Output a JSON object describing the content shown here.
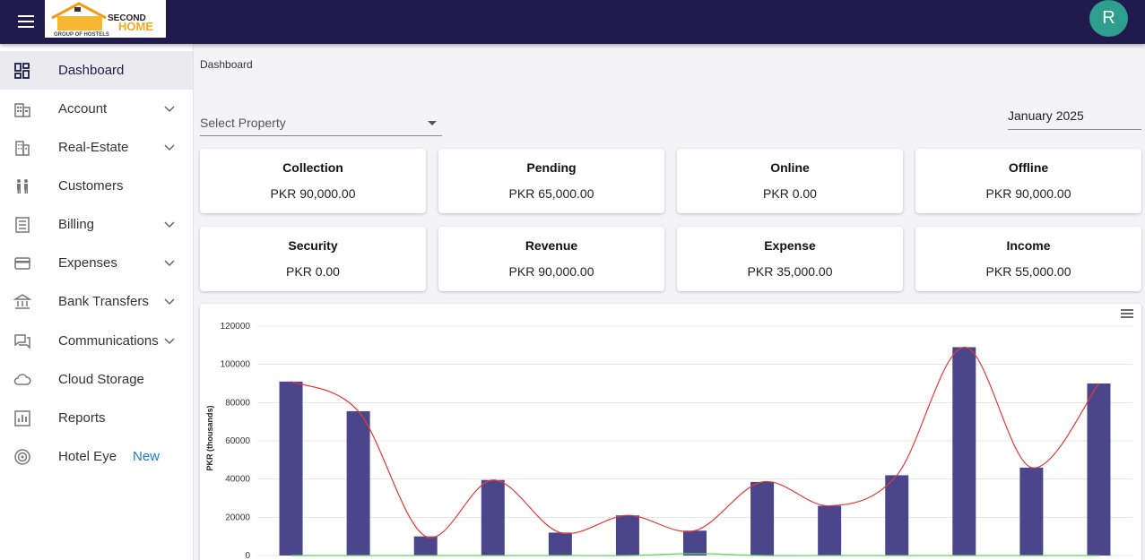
{
  "header": {
    "logo": {
      "top_word": "SECOND",
      "brand": "HOME",
      "tagline": "GROUP OF HOSTELS"
    },
    "avatar_initial": "R",
    "colors": {
      "topbar": "#201a4f",
      "avatar": "#2e9e8f"
    }
  },
  "sidebar": {
    "items": [
      {
        "label": "Dashboard",
        "icon": "dashboard-icon",
        "expandable": false,
        "active": true
      },
      {
        "label": "Account",
        "icon": "building-icon",
        "expandable": true
      },
      {
        "label": "Real-Estate",
        "icon": "apartment-icon",
        "expandable": true
      },
      {
        "label": "Customers",
        "icon": "people-icon",
        "expandable": false
      },
      {
        "label": "Billing",
        "icon": "receipt-icon",
        "expandable": true
      },
      {
        "label": "Expenses",
        "icon": "credit-card-icon",
        "expandable": true
      },
      {
        "label": "Bank Transfers",
        "icon": "bank-icon",
        "expandable": true
      },
      {
        "label": "Communications",
        "icon": "chat-icon",
        "expandable": true
      },
      {
        "label": "Cloud Storage",
        "icon": "cloud-icon",
        "expandable": false
      },
      {
        "label": "Reports",
        "icon": "bar-chart-icon",
        "expandable": false
      },
      {
        "label": "Hotel Eye",
        "icon": "radar-icon",
        "expandable": false,
        "badge": "New"
      }
    ]
  },
  "breadcrumb": "Dashboard",
  "filters": {
    "property_placeholder": "Select Property",
    "month": "January 2025"
  },
  "cards": [
    {
      "title": "Collection",
      "value": "PKR 90,000.00"
    },
    {
      "title": "Pending",
      "value": "PKR 65,000.00"
    },
    {
      "title": "Online",
      "value": "PKR 0.00"
    },
    {
      "title": "Offline",
      "value": "PKR 90,000.00"
    },
    {
      "title": "Security",
      "value": "PKR 0.00"
    },
    {
      "title": "Revenue",
      "value": "PKR 90,000.00"
    },
    {
      "title": "Expense",
      "value": "PKR 35,000.00"
    },
    {
      "title": "Income",
      "value": "PKR 55,000.00"
    }
  ],
  "chart_data": {
    "type": "bar",
    "ylabel": "PKR (thousands)",
    "ylim": [
      0,
      120000
    ],
    "yticks": [
      0,
      20000,
      40000,
      60000,
      80000,
      100000,
      120000
    ],
    "grid": true,
    "series": [
      {
        "type": "bar",
        "color": "#4b468c",
        "values": [
          91000,
          75500,
          10000,
          39500,
          12000,
          21000,
          13000,
          38500,
          26000,
          42000,
          109000,
          46000,
          90000
        ]
      },
      {
        "type": "line",
        "color": "#e53935",
        "values": [
          91000,
          75500,
          10000,
          39500,
          12000,
          21000,
          13000,
          38500,
          26000,
          42000,
          109000,
          46000,
          90000
        ]
      },
      {
        "type": "line",
        "color": "#5cd65c",
        "values": [
          0,
          0,
          0,
          0,
          0,
          0,
          1000,
          0,
          0,
          0,
          0,
          0,
          0
        ]
      }
    ]
  }
}
